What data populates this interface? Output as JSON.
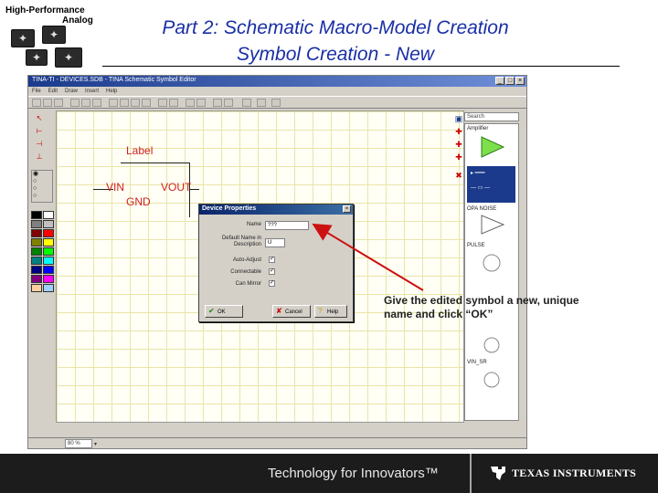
{
  "slide": {
    "logo_line1": "High-Performance",
    "logo_line2": "Analog",
    "title_line1": "Part 2: Schematic Macro-Model Creation",
    "title_line2": "Symbol Creation - New"
  },
  "app_window": {
    "title": "TINA-TI - DEVICES.SDB - TINA Schematic Symbol Editor",
    "menu": [
      "File",
      "Edit",
      "Draw",
      "Insert",
      "Help"
    ],
    "canvas_symbol": {
      "label": "Label",
      "pin_vin": "VIN",
      "pin_vout": "VOUT",
      "pin_gnd": "GND"
    },
    "library": {
      "search_placeholder": "Search",
      "items": [
        "Amplifier",
        "OPA NOISE",
        "PULSE",
        "VIN_SR"
      ]
    },
    "status": {
      "zoom": "80 %"
    }
  },
  "dialog": {
    "title": "Device Properties",
    "name_label": "Name",
    "name_value": "???",
    "desc_label": "Default Name in Description",
    "desc_value": "U",
    "checks": [
      {
        "label": "Auto-Adjust",
        "checked": true
      },
      {
        "label": "Connectable",
        "checked": true
      },
      {
        "label": "Can Mirror",
        "checked": true
      }
    ],
    "buttons": {
      "ok": "OK",
      "cancel": "Cancel",
      "help": "Help"
    }
  },
  "annotation": {
    "callout": "Give the edited symbol a new, unique name and click “OK”"
  },
  "footer": {
    "tagline": "Technology for Innovators™",
    "company": "TEXAS INSTRUMENTS"
  },
  "colors": {
    "title_blue": "#1a2fa6",
    "symbol_red": "#d02020",
    "arrow_red": "#cc1111",
    "footer_bg": "#1c1c1c"
  }
}
